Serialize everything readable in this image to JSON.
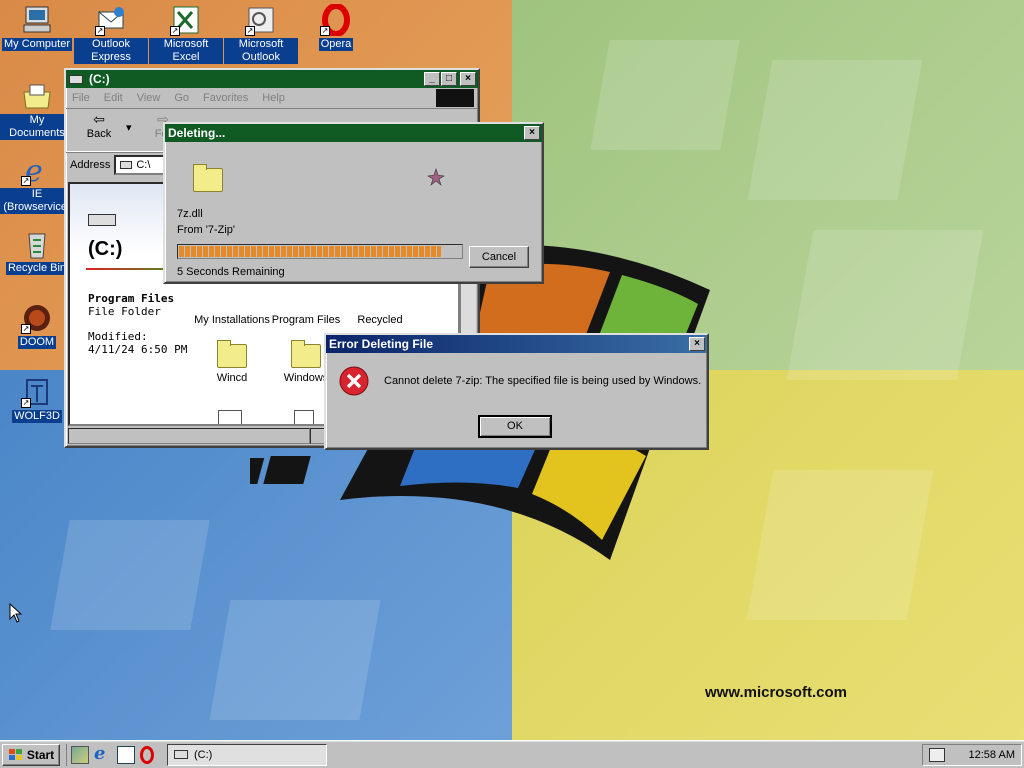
{
  "desktop": {
    "icons": [
      {
        "label": "My Computer"
      },
      {
        "label": "Outlook Express"
      },
      {
        "label": "Microsoft Excel"
      },
      {
        "label": "Microsoft Outlook"
      },
      {
        "label": "Opera"
      },
      {
        "label": "My Documents"
      },
      {
        "label": "IE (Browservice)"
      },
      {
        "label": "Recycle Bin"
      },
      {
        "label": "DOOM"
      },
      {
        "label": "WOLF3D"
      }
    ],
    "wallpaper_text": "www.microsoft.com"
  },
  "explorer": {
    "title": "(C:)",
    "menu": [
      "File",
      "Edit",
      "View",
      "Go",
      "Favorites",
      "Help"
    ],
    "toolbar": {
      "back": "Back",
      "forward": "For"
    },
    "address_label": "Address",
    "address_value": "C:\\",
    "drive_title": "(C:)",
    "selection": {
      "name": "Program Files",
      "type": "File Folder",
      "modified_label": "Modified:",
      "modified_value": "4/11/24 6:50 PM"
    },
    "files": [
      {
        "name": "My Installations"
      },
      {
        "name": "Program Files"
      },
      {
        "name": "Recycled"
      },
      {
        "name": "Wincd"
      },
      {
        "name": "Windows"
      }
    ]
  },
  "deleting": {
    "title": "Deleting...",
    "file": "7z.dll",
    "from": "From '7-Zip'",
    "remaining": "5 Seconds Remaining",
    "cancel": "Cancel",
    "progress": 0.93
  },
  "error": {
    "title": "Error Deleting File",
    "message": "Cannot delete 7-zip: The specified file is being used by Windows.",
    "ok": "OK"
  },
  "taskbar": {
    "start": "Start",
    "task": "(C:)",
    "clock": "12:58 AM"
  },
  "colors": {
    "title_green": "#0f5b23",
    "title_navy": "#0a246a",
    "progress": "#e58a2a",
    "error_red": "#d9232e"
  }
}
